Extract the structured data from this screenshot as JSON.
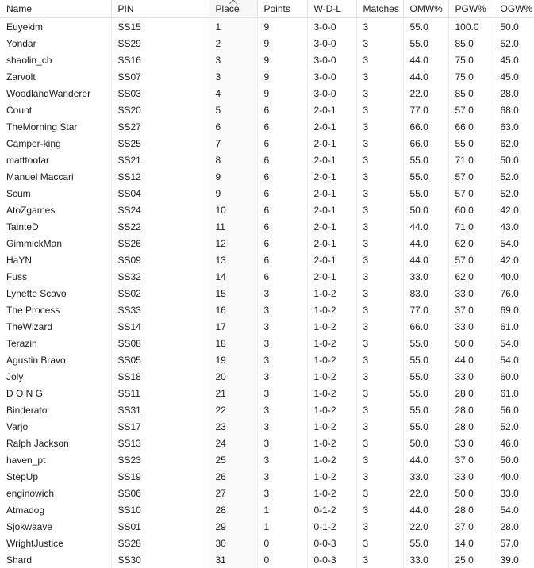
{
  "table": {
    "sort": {
      "column": "Place",
      "direction": "ascending",
      "caret_icon": "chevron-up-icon"
    },
    "columns": [
      {
        "key": "name",
        "label": "Name"
      },
      {
        "key": "pin",
        "label": "PIN"
      },
      {
        "key": "place",
        "label": "Place"
      },
      {
        "key": "points",
        "label": "Points"
      },
      {
        "key": "wdl",
        "label": "W-D-L"
      },
      {
        "key": "matches",
        "label": "Matches"
      },
      {
        "key": "omw",
        "label": "OMW%"
      },
      {
        "key": "pgw",
        "label": "PGW%"
      },
      {
        "key": "ogw",
        "label": "OGW%"
      }
    ],
    "rows": [
      {
        "name": "Euyekim",
        "pin": "SS15",
        "place": "1",
        "points": "9",
        "wdl": "3-0-0",
        "matches": "3",
        "omw": "55.0",
        "pgw": "100.0",
        "ogw": "50.0"
      },
      {
        "name": "Yondar",
        "pin": "SS29",
        "place": "2",
        "points": "9",
        "wdl": "3-0-0",
        "matches": "3",
        "omw": "55.0",
        "pgw": "85.0",
        "ogw": "52.0"
      },
      {
        "name": "shaolin_cb",
        "pin": "SS16",
        "place": "3",
        "points": "9",
        "wdl": "3-0-0",
        "matches": "3",
        "omw": "44.0",
        "pgw": "75.0",
        "ogw": "45.0"
      },
      {
        "name": "Zarvolt",
        "pin": "SS07",
        "place": "3",
        "points": "9",
        "wdl": "3-0-0",
        "matches": "3",
        "omw": "44.0",
        "pgw": "75.0",
        "ogw": "45.0"
      },
      {
        "name": "WoodlandWanderer",
        "pin": "SS03",
        "place": "4",
        "points": "9",
        "wdl": "3-0-0",
        "matches": "3",
        "omw": "22.0",
        "pgw": "85.0",
        "ogw": "28.0"
      },
      {
        "name": "Count",
        "pin": "SS20",
        "place": "5",
        "points": "6",
        "wdl": "2-0-1",
        "matches": "3",
        "omw": "77.0",
        "pgw": "57.0",
        "ogw": "68.0"
      },
      {
        "name": "TheMorning Star",
        "pin": "SS27",
        "place": "6",
        "points": "6",
        "wdl": "2-0-1",
        "matches": "3",
        "omw": "66.0",
        "pgw": "66.0",
        "ogw": "63.0"
      },
      {
        "name": "Camper-king",
        "pin": "SS25",
        "place": "7",
        "points": "6",
        "wdl": "2-0-1",
        "matches": "3",
        "omw": "66.0",
        "pgw": "55.0",
        "ogw": "62.0"
      },
      {
        "name": "matttoofar",
        "pin": "SS21",
        "place": "8",
        "points": "6",
        "wdl": "2-0-1",
        "matches": "3",
        "omw": "55.0",
        "pgw": "71.0",
        "ogw": "50.0"
      },
      {
        "name": "Manuel Maccari",
        "pin": "SS12",
        "place": "9",
        "points": "6",
        "wdl": "2-0-1",
        "matches": "3",
        "omw": "55.0",
        "pgw": "57.0",
        "ogw": "52.0"
      },
      {
        "name": "Scum",
        "pin": "SS04",
        "place": "9",
        "points": "6",
        "wdl": "2-0-1",
        "matches": "3",
        "omw": "55.0",
        "pgw": "57.0",
        "ogw": "52.0"
      },
      {
        "name": "AtoZgames",
        "pin": "SS24",
        "place": "10",
        "points": "6",
        "wdl": "2-0-1",
        "matches": "3",
        "omw": "50.0",
        "pgw": "60.0",
        "ogw": "42.0"
      },
      {
        "name": "TainteD",
        "pin": "SS22",
        "place": "11",
        "points": "6",
        "wdl": "2-0-1",
        "matches": "3",
        "omw": "44.0",
        "pgw": "71.0",
        "ogw": "43.0"
      },
      {
        "name": "GimmickMan",
        "pin": "SS26",
        "place": "12",
        "points": "6",
        "wdl": "2-0-1",
        "matches": "3",
        "omw": "44.0",
        "pgw": "62.0",
        "ogw": "54.0"
      },
      {
        "name": "HaYN",
        "pin": "SS09",
        "place": "13",
        "points": "6",
        "wdl": "2-0-1",
        "matches": "3",
        "omw": "44.0",
        "pgw": "57.0",
        "ogw": "42.0"
      },
      {
        "name": "Fuss",
        "pin": "SS32",
        "place": "14",
        "points": "6",
        "wdl": "2-0-1",
        "matches": "3",
        "omw": "33.0",
        "pgw": "62.0",
        "ogw": "40.0"
      },
      {
        "name": "Lynette Scavo",
        "pin": "SS02",
        "place": "15",
        "points": "3",
        "wdl": "1-0-2",
        "matches": "3",
        "omw": "83.0",
        "pgw": "33.0",
        "ogw": "76.0"
      },
      {
        "name": "The Process",
        "pin": "SS33",
        "place": "16",
        "points": "3",
        "wdl": "1-0-2",
        "matches": "3",
        "omw": "77.0",
        "pgw": "37.0",
        "ogw": "69.0"
      },
      {
        "name": "TheWizard",
        "pin": "SS14",
        "place": "17",
        "points": "3",
        "wdl": "1-0-2",
        "matches": "3",
        "omw": "66.0",
        "pgw": "33.0",
        "ogw": "61.0"
      },
      {
        "name": "Terazin",
        "pin": "SS08",
        "place": "18",
        "points": "3",
        "wdl": "1-0-2",
        "matches": "3",
        "omw": "55.0",
        "pgw": "50.0",
        "ogw": "54.0"
      },
      {
        "name": "Agustin Bravo",
        "pin": "SS05",
        "place": "19",
        "points": "3",
        "wdl": "1-0-2",
        "matches": "3",
        "omw": "55.0",
        "pgw": "44.0",
        "ogw": "54.0"
      },
      {
        "name": "Joly",
        "pin": "SS18",
        "place": "20",
        "points": "3",
        "wdl": "1-0-2",
        "matches": "3",
        "omw": "55.0",
        "pgw": "33.0",
        "ogw": "60.0"
      },
      {
        "name": "D O N G",
        "pin": "SS11",
        "place": "21",
        "points": "3",
        "wdl": "1-0-2",
        "matches": "3",
        "omw": "55.0",
        "pgw": "28.0",
        "ogw": "61.0"
      },
      {
        "name": "Binderato",
        "pin": "SS31",
        "place": "22",
        "points": "3",
        "wdl": "1-0-2",
        "matches": "3",
        "omw": "55.0",
        "pgw": "28.0",
        "ogw": "56.0"
      },
      {
        "name": "Varjo",
        "pin": "SS17",
        "place": "23",
        "points": "3",
        "wdl": "1-0-2",
        "matches": "3",
        "omw": "55.0",
        "pgw": "28.0",
        "ogw": "52.0"
      },
      {
        "name": "Ralph Jackson",
        "pin": "SS13",
        "place": "24",
        "points": "3",
        "wdl": "1-0-2",
        "matches": "3",
        "omw": "50.0",
        "pgw": "33.0",
        "ogw": "46.0"
      },
      {
        "name": "haven_pt",
        "pin": "SS23",
        "place": "25",
        "points": "3",
        "wdl": "1-0-2",
        "matches": "3",
        "omw": "44.0",
        "pgw": "37.0",
        "ogw": "50.0"
      },
      {
        "name": "StepUp",
        "pin": "SS19",
        "place": "26",
        "points": "3",
        "wdl": "1-0-2",
        "matches": "3",
        "omw": "33.0",
        "pgw": "33.0",
        "ogw": "40.0"
      },
      {
        "name": "enginowich",
        "pin": "SS06",
        "place": "27",
        "points": "3",
        "wdl": "1-0-2",
        "matches": "3",
        "omw": "22.0",
        "pgw": "50.0",
        "ogw": "33.0"
      },
      {
        "name": "Atmadog",
        "pin": "SS10",
        "place": "28",
        "points": "1",
        "wdl": "0-1-2",
        "matches": "3",
        "omw": "44.0",
        "pgw": "28.0",
        "ogw": "54.0"
      },
      {
        "name": "Sjokwaave",
        "pin": "SS01",
        "place": "29",
        "points": "1",
        "wdl": "0-1-2",
        "matches": "3",
        "omw": "22.0",
        "pgw": "37.0",
        "ogw": "28.0"
      },
      {
        "name": "WrightJustice",
        "pin": "SS28",
        "place": "30",
        "points": "0",
        "wdl": "0-0-3",
        "matches": "3",
        "omw": "55.0",
        "pgw": "14.0",
        "ogw": "57.0"
      },
      {
        "name": "Shard",
        "pin": "SS30",
        "place": "31",
        "points": "0",
        "wdl": "0-0-3",
        "matches": "3",
        "omw": "33.0",
        "pgw": "25.0",
        "ogw": "39.0"
      }
    ]
  },
  "colors": {
    "text": "#1b1b1b",
    "background": "#ffffff",
    "header_border": "#e1e1e1",
    "cell_border": "#efefef",
    "sorted_column_header_bg": "#f7f7f7",
    "sorted_column_cell_bg": "#fafafa"
  }
}
